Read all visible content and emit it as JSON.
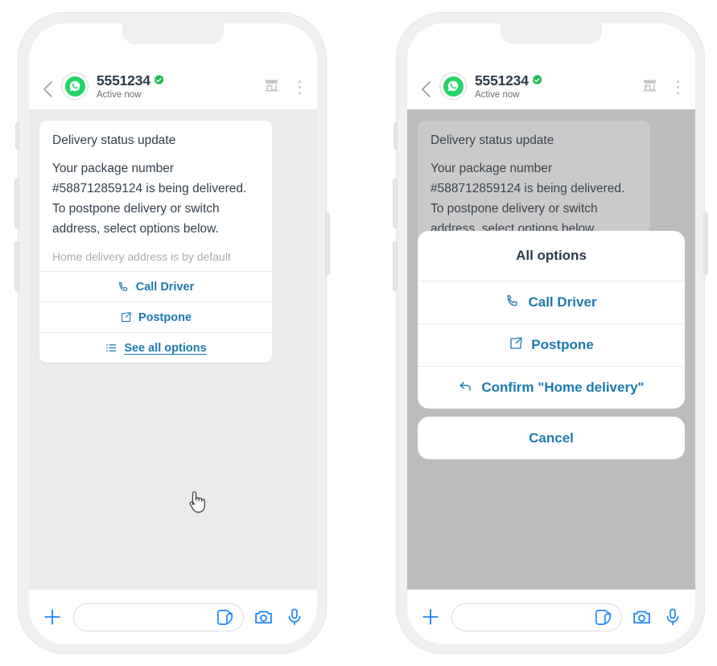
{
  "colors": {
    "accent_blue": "#1b79b0",
    "bar_blue": "#1a85fb",
    "whatsapp_green": "#25D366",
    "verified_green": "#22bb55",
    "header_name": "#2b3a4a",
    "chat_bg": "#ebebeb",
    "frame": "#f0f0ee"
  },
  "header": {
    "back_icon": "chevron-left-icon",
    "avatar_icon": "whatsapp-logo-icon",
    "name": "5551234",
    "verified_icon": "verified-badge-icon",
    "status": "Active now",
    "shop_icon": "storefront-icon",
    "menu_icon": "kebab-menu-icon"
  },
  "message": {
    "title": "Delivery status update",
    "body": "Your package number #588712859124 is being delivered. To postpone delivery or switch address, select options below.",
    "note": "Home delivery address is by default",
    "actions": [
      {
        "label": "Call Driver",
        "icon": "phone-icon",
        "underline": false
      },
      {
        "label": "Postpone",
        "icon": "external-link-icon",
        "underline": false
      },
      {
        "label": "See all options",
        "icon": "list-icon",
        "underline": true
      }
    ]
  },
  "modal": {
    "title": "All options",
    "options": [
      {
        "label": "Call Driver",
        "icon": "phone-icon"
      },
      {
        "label": "Postpone",
        "icon": "external-link-icon"
      },
      {
        "label": "Confirm \"Home delivery\"",
        "icon": "reply-arrow-icon"
      }
    ],
    "cancel_label": "Cancel"
  },
  "input_bar": {
    "plus_icon": "plus-icon",
    "field_value": "",
    "field_placeholder": "",
    "sticker_icon": "sticker-icon",
    "camera_icon": "camera-icon",
    "mic_icon": "microphone-icon"
  },
  "cursor": {
    "icon": "pointing-hand-cursor"
  }
}
